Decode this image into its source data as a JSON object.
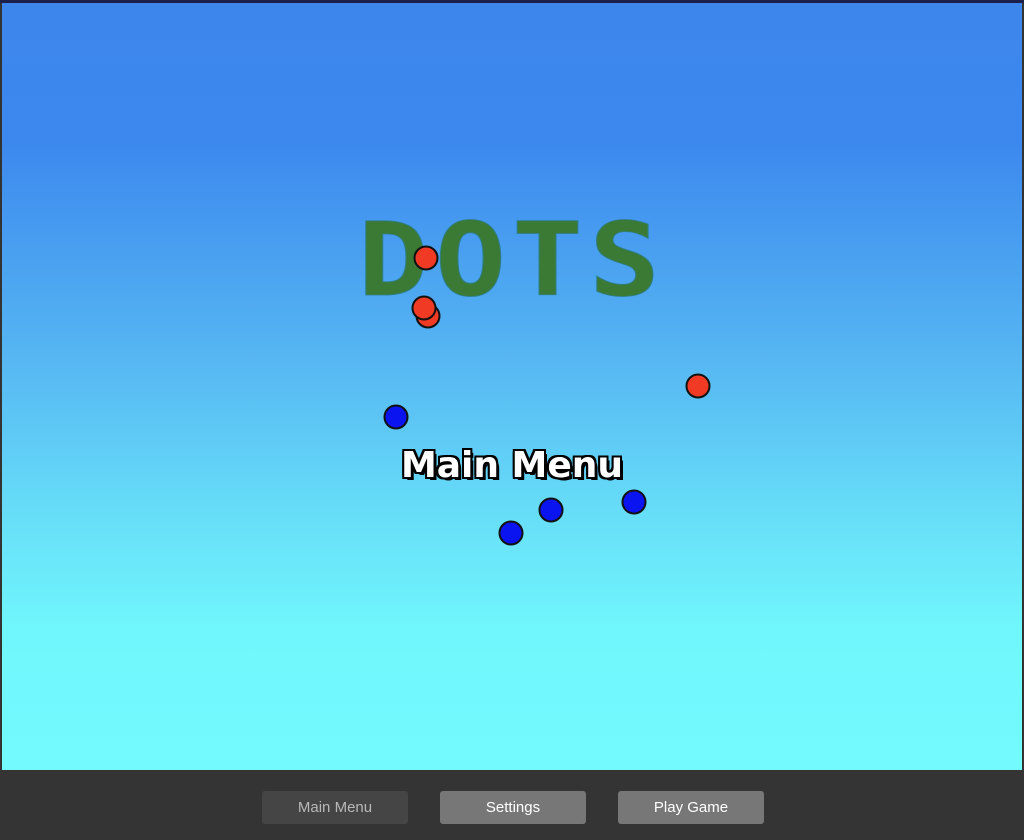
{
  "game": {
    "title": "DOTS",
    "screen_heading": "Main Menu",
    "colors": {
      "sky_top": "#3d86ec",
      "sky_bottom": "#72fafe",
      "title_green": "#3b7a34",
      "red_dot": "#f03a23",
      "blue_dot": "#0a14f0"
    },
    "dots": {
      "red_count": 4,
      "blue_count": 4
    }
  },
  "bottom_bar": {
    "buttons": [
      {
        "label": "Main Menu",
        "state": "disabled"
      },
      {
        "label": "Settings",
        "state": "enabled"
      },
      {
        "label": "Play Game",
        "state": "enabled"
      }
    ]
  }
}
